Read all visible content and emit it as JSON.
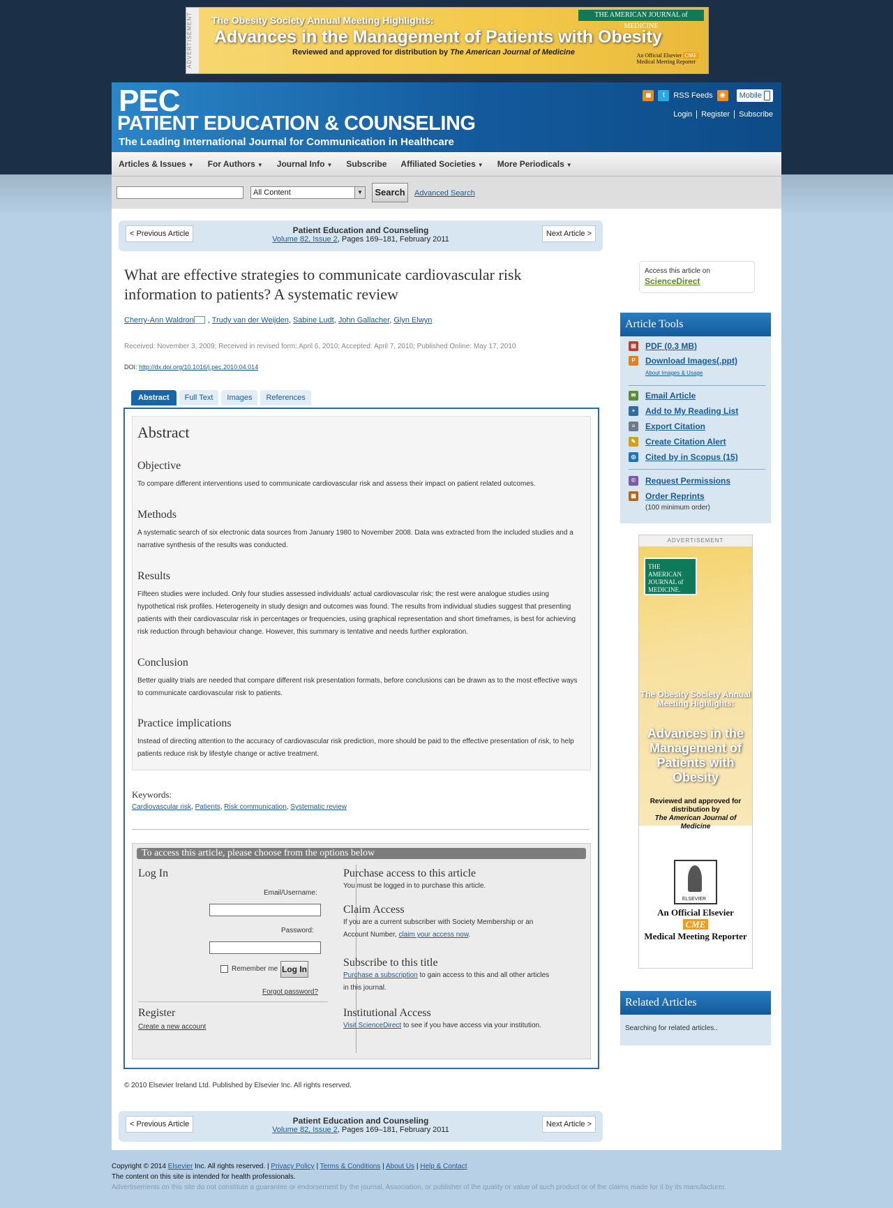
{
  "top_ad": {
    "tag": "ADVERTISEMENT",
    "line1": "The Obesity Society Annual Meeting Highlights:",
    "line2": "Advances in the Management of Patients with Obesity",
    "line3_prefix": "Reviewed and approved for distribution by ",
    "line3_journal": "The American Journal of Medicine",
    "journal_badge": "THE AMERICAN JOURNAL of MEDICINE",
    "badge_line1": "An Official Elsevier",
    "badge_cme": "CME",
    "badge_line2": "Medical Meeting Reporter"
  },
  "masthead": {
    "acronym": "PEC",
    "journal_name": "PATIENT EDUCATION & COUNSELING",
    "tagline": "The Leading International Journal for Communication in Healthcare",
    "rss_label": "RSS Feeds",
    "mobile_label": "Mobile",
    "links": [
      "Login",
      "Register",
      "Subscribe"
    ]
  },
  "nav": [
    {
      "label": "Articles & Issues",
      "dropdown": true
    },
    {
      "label": "For Authors",
      "dropdown": true
    },
    {
      "label": "Journal Info",
      "dropdown": true
    },
    {
      "label": "Subscribe",
      "dropdown": false
    },
    {
      "label": "Affiliated Societies",
      "dropdown": true
    },
    {
      "label": "More Periodicals",
      "dropdown": true
    }
  ],
  "search": {
    "input_value": "",
    "scope": "All Content",
    "button": "Search",
    "advanced": "Advanced Search"
  },
  "article_nav": {
    "prev": "< Previous Article",
    "next": "Next Article >",
    "journal": "Patient Education and Counseling",
    "volume_issue": "Volume 82, Issue 2",
    "pages_date": ", Pages 169–181, February 2011"
  },
  "article": {
    "title": "What are effective strategies to communicate cardiovascular risk information to patients? A systematic review",
    "authors": [
      "Cherry-Ann Waldron",
      "Trudy van der Weijden",
      "Sabine Ludt",
      "John Gallacher",
      "Glyn Elwyn"
    ],
    "dates": "Received: November 3, 2009; Received in revised form: April 6, 2010; Accepted: April 7, 2010; Published Online: May 17, 2010",
    "doi_label": "DOI: ",
    "doi_link": "http://dx.doi.org/10.1016/j.pec.2010.04.014"
  },
  "tabs": [
    "Abstract",
    "Full Text",
    "Images",
    "References"
  ],
  "abstract": {
    "heading": "Abstract",
    "sections": [
      {
        "title": "Objective",
        "text": "To compare different interventions used to communicate cardiovascular risk and assess their impact on patient related outcomes."
      },
      {
        "title": "Methods",
        "text": "A systematic search of six electronic data sources from January 1980 to November 2008. Data was extracted from the included studies and a narrative synthesis of the results was conducted."
      },
      {
        "title": "Results",
        "text": "Fifteen studies were included. Only four studies assessed individuals' actual cardiovascular risk; the rest were analogue studies using hypothetical risk profiles. Heterogeneity in study design and outcomes was found. The results from individual studies suggest that presenting patients with their cardiovascular risk in percentages or frequencies, using graphical representation and short timeframes, is best for achieving risk reduction through behaviour change. However, this summary is tentative and needs further exploration."
      },
      {
        "title": "Conclusion",
        "text": "Better quality trials are needed that compare different risk presentation formats, before conclusions can be drawn as to the most effective ways to communicate cardiovascular risk to patients."
      },
      {
        "title": "Practice implications",
        "text": "Instead of directing attention to the accuracy of cardiovascular risk prediction, more should be paid to the effective presentation of risk, to help patients reduce risk by lifestyle change or active treatment."
      }
    ]
  },
  "keywords": {
    "label": "Keywords:",
    "items": [
      "Cardiovascular risk",
      "Patients",
      "Risk communication",
      "Systematic review"
    ]
  },
  "access": {
    "banner": "To access this article, please choose from the options below",
    "login_title": "Log In",
    "email_label": "Email/Username:",
    "password_label": "Password:",
    "remember": "Remember me",
    "login_button": "Log In",
    "forgot": "Forgot password?",
    "register_title": "Register",
    "register_link": "Create a new account",
    "purchase_title": "Purchase access to this article",
    "purchase_text": "You must be logged in to purchase this article.",
    "claim_title": "Claim Access",
    "claim_text1": "If you are a current subscriber with Society Membership or an Account Number, ",
    "claim_link": "claim your access now",
    "claim_text2": ".",
    "subscribe_title": "Subscribe to this title",
    "subscribe_link": "Purchase a subscription",
    "subscribe_text": " to gain access to this and all other articles in this journal.",
    "inst_title": "Institutional Access",
    "inst_link": "Visit ScienceDirect",
    "inst_text": " to see if you have access via your institution."
  },
  "copyright": "© 2010 Elsevier Ireland Ltd. Published by Elsevier Inc. All rights reserved.",
  "sidebar": {
    "access_label": "Access this article on",
    "sciencedirect": "ScienceDirect",
    "tools_title": "Article Tools",
    "tools": [
      {
        "label": "PDF (0.3 MB)",
        "icon": "pdf-icon",
        "color": "#c0392b"
      },
      {
        "label": "Download Images(.ppt)",
        "icon": "ppt-icon",
        "color": "#e67e22"
      },
      {
        "label": "Email Article",
        "icon": "email-icon",
        "color": "#5d8a3a"
      },
      {
        "label": "Add to My Reading List",
        "icon": "reading-list-icon",
        "color": "#2e6da4"
      },
      {
        "label": "Export Citation",
        "icon": "export-icon",
        "color": "#6c7a89"
      },
      {
        "label": "Create Citation Alert",
        "icon": "alert-icon",
        "color": "#d4a017"
      },
      {
        "label": "Cited by in Scopus (15)",
        "icon": "scopus-icon",
        "color": "#1f73b7"
      },
      {
        "label": "Request Permissions",
        "icon": "permissions-icon",
        "color": "#7d5ba6"
      },
      {
        "label": "Order Reprints",
        "icon": "reprints-icon",
        "color": "#b5651d"
      }
    ],
    "images_usage": "About Images & Usage",
    "reprints_note": "(100 minimum order)",
    "ad": {
      "tag": "ADVERTISEMENT",
      "journal": "THE AMERICAN JOURNAL of MEDICINE.",
      "line1": "The Obesity Society Annual Meeting Highlights:",
      "line2": "Advances in the Management of Patients with Obesity",
      "line3": "Reviewed and approved for distribution by",
      "line4": "The American Journal of Medicine",
      "publisher": "ELSEVIER",
      "official": "An Official Elsevier",
      "cme": "CME",
      "reporter": "Medical Meeting Reporter"
    },
    "related_title": "Related Articles",
    "related_text": "Searching for related articles.."
  },
  "footer": {
    "copyright_prefix": "Copyright © 2014 ",
    "elsevier": "Elsevier",
    "copyright_suffix": " Inc. All rights reserved. | ",
    "links": [
      "Privacy Policy",
      "Terms & Conditions",
      "About Us",
      "Help & Contact"
    ],
    "line2": "The content on this site is intended for health professionals.",
    "line3": "Advertisements on this site do not constitute a guarantee or endorsement by the journal, Association, or publisher of the quality or value of such product or of the claims made for it by its manufacturer."
  }
}
